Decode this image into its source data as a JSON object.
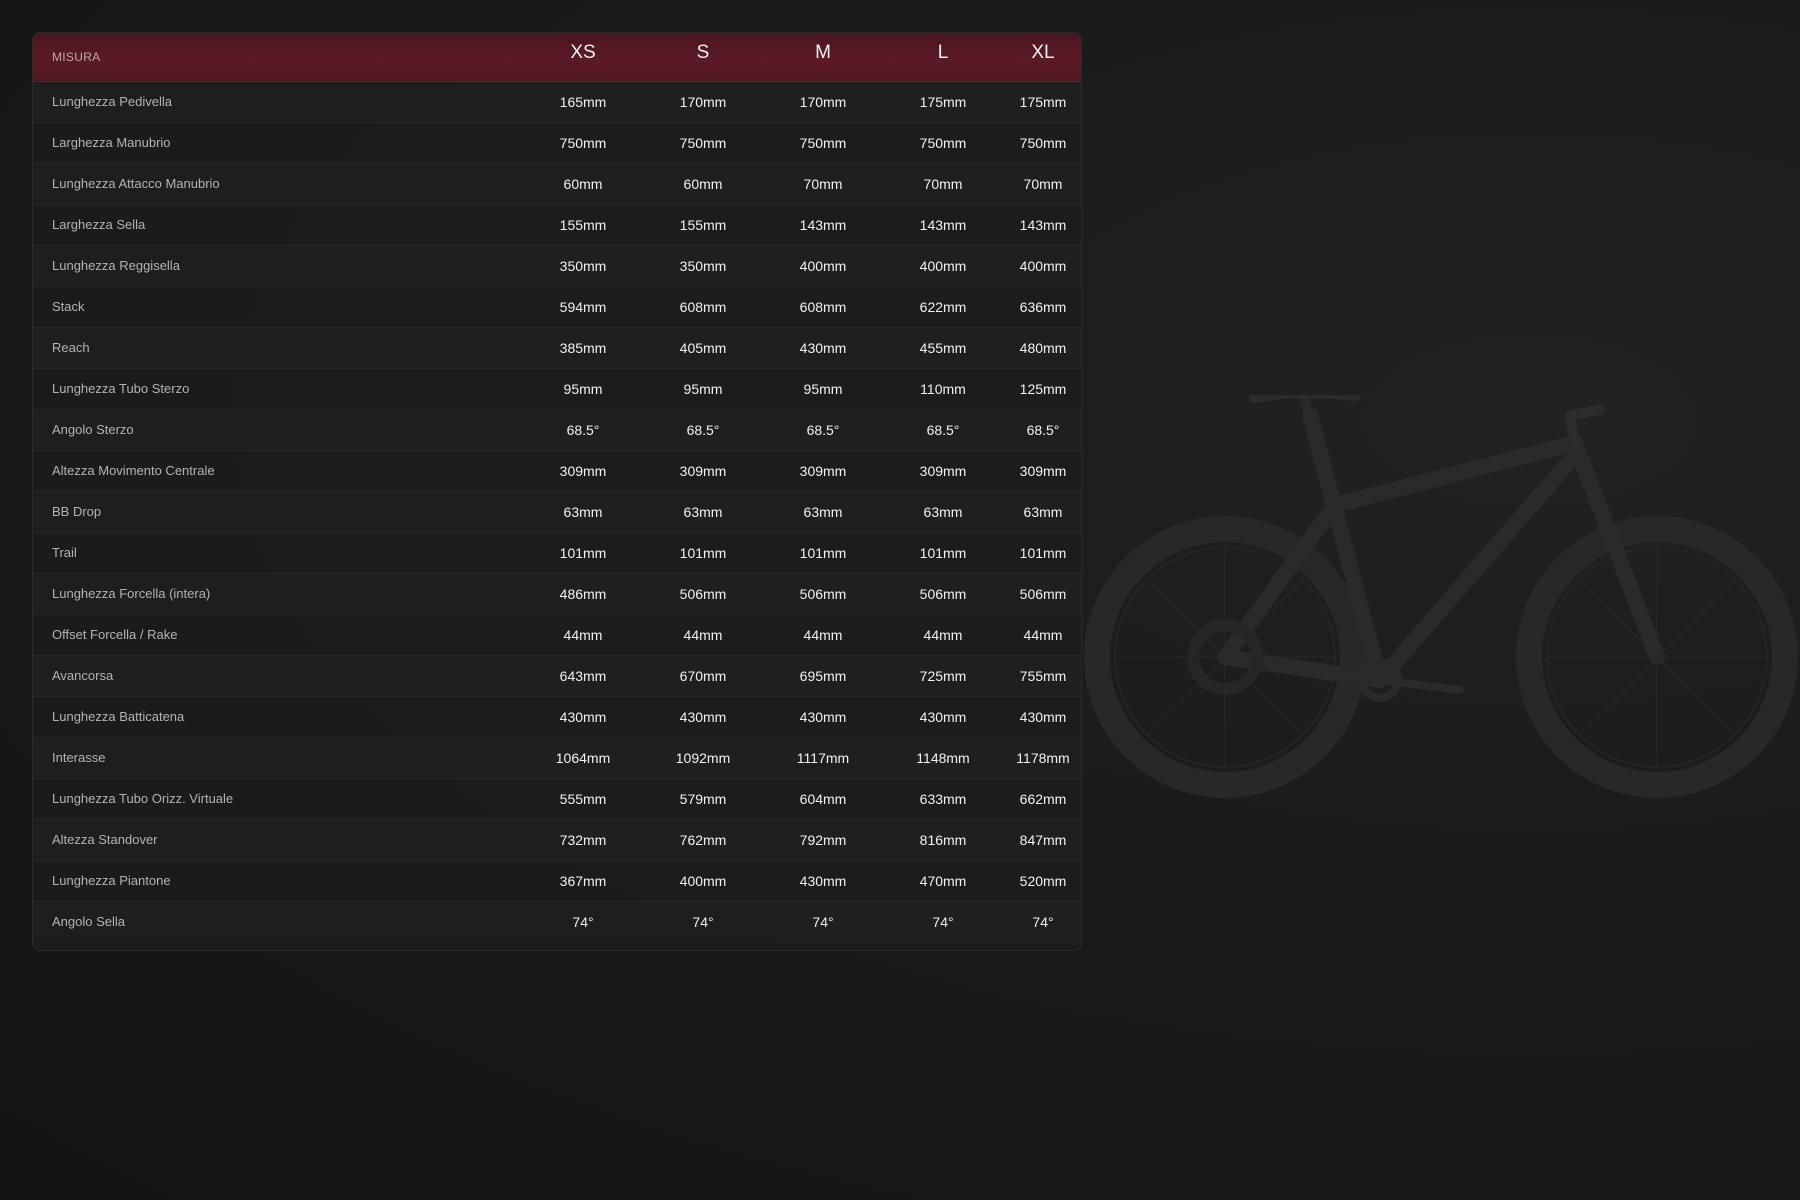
{
  "header": {
    "label": "MISURA",
    "sizes": [
      "XS",
      "S",
      "M",
      "L",
      "XL"
    ]
  },
  "rows": [
    {
      "label": "Lunghezza Pedivella",
      "values": [
        "165mm",
        "170mm",
        "170mm",
        "175mm",
        "175mm"
      ]
    },
    {
      "label": "Larghezza Manubrio",
      "values": [
        "750mm",
        "750mm",
        "750mm",
        "750mm",
        "750mm"
      ]
    },
    {
      "label": "Lunghezza Attacco Manubrio",
      "values": [
        "60mm",
        "60mm",
        "70mm",
        "70mm",
        "70mm"
      ]
    },
    {
      "label": "Larghezza Sella",
      "values": [
        "155mm",
        "155mm",
        "143mm",
        "143mm",
        "143mm"
      ]
    },
    {
      "label": "Lunghezza Reggisella",
      "values": [
        "350mm",
        "350mm",
        "400mm",
        "400mm",
        "400mm"
      ]
    },
    {
      "label": "Stack",
      "values": [
        "594mm",
        "608mm",
        "608mm",
        "622mm",
        "636mm"
      ]
    },
    {
      "label": "Reach",
      "values": [
        "385mm",
        "405mm",
        "430mm",
        "455mm",
        "480mm"
      ]
    },
    {
      "label": "Lunghezza Tubo Sterzo",
      "values": [
        "95mm",
        "95mm",
        "95mm",
        "110mm",
        "125mm"
      ]
    },
    {
      "label": "Angolo Sterzo",
      "values": [
        "68.5°",
        "68.5°",
        "68.5°",
        "68.5°",
        "68.5°"
      ]
    },
    {
      "label": "Altezza Movimento Centrale",
      "values": [
        "309mm",
        "309mm",
        "309mm",
        "309mm",
        "309mm"
      ]
    },
    {
      "label": "BB Drop",
      "values": [
        "63mm",
        "63mm",
        "63mm",
        "63mm",
        "63mm"
      ]
    },
    {
      "label": "Trail",
      "values": [
        "101mm",
        "101mm",
        "101mm",
        "101mm",
        "101mm"
      ]
    },
    {
      "label": "Lunghezza Forcella (intera)",
      "values": [
        "486mm",
        "506mm",
        "506mm",
        "506mm",
        "506mm"
      ]
    },
    {
      "label": "Offset Forcella / Rake",
      "values": [
        "44mm",
        "44mm",
        "44mm",
        "44mm",
        "44mm"
      ]
    },
    {
      "label": "Avancorsa",
      "values": [
        "643mm",
        "670mm",
        "695mm",
        "725mm",
        "755mm"
      ]
    },
    {
      "label": "Lunghezza Batticatena",
      "values": [
        "430mm",
        "430mm",
        "430mm",
        "430mm",
        "430mm"
      ]
    },
    {
      "label": "Interasse",
      "values": [
        "1064mm",
        "1092mm",
        "1117mm",
        "1148mm",
        "1178mm"
      ]
    },
    {
      "label": "Lunghezza Tubo Orizz. Virtuale",
      "values": [
        "555mm",
        "579mm",
        "604mm",
        "633mm",
        "662mm"
      ]
    },
    {
      "label": "Altezza Standover",
      "values": [
        "732mm",
        "762mm",
        "792mm",
        "816mm",
        "847mm"
      ]
    },
    {
      "label": "Lunghezza Piantone",
      "values": [
        "367mm",
        "400mm",
        "430mm",
        "470mm",
        "520mm"
      ]
    },
    {
      "label": "Angolo Sella",
      "values": [
        "74°",
        "74°",
        "74°",
        "74°",
        "74°"
      ]
    }
  ],
  "colors": {
    "header_accent": "#5b1a26",
    "background": "#1a1a1a",
    "value_text": "#f2f2f2",
    "label_text": "#b3b3b3"
  },
  "icons": {
    "background_image": "bike-silhouette-icon"
  }
}
